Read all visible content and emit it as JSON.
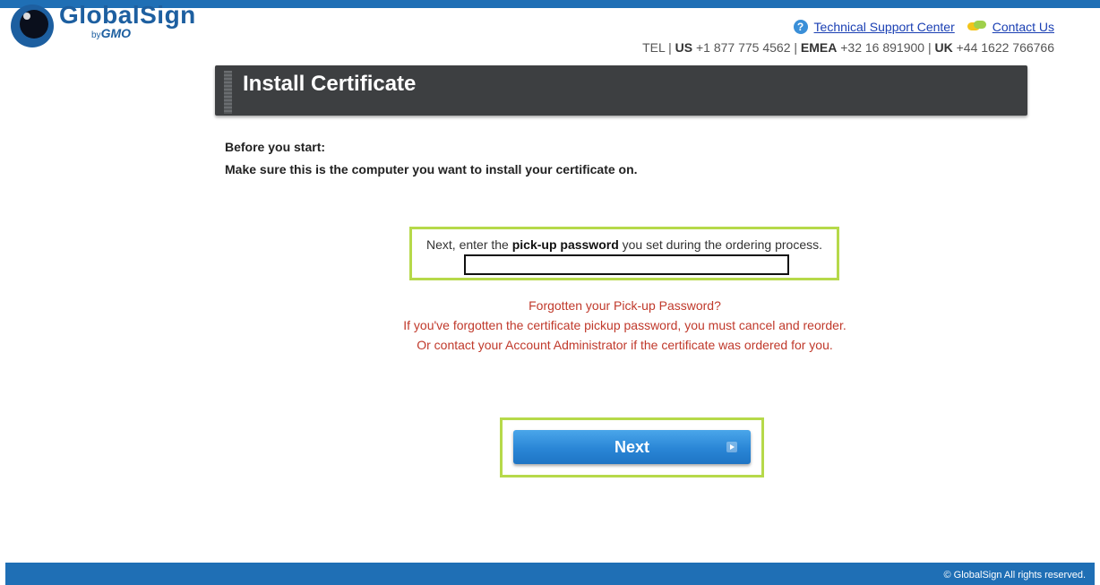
{
  "brand": {
    "name": "GlobalSign",
    "by": "by",
    "parent": "GMO"
  },
  "header": {
    "support_link": "Technical Support Center",
    "contact_link": "Contact Us",
    "tel_prefix": "TEL | ",
    "us_label": "US",
    "us_phone": " +1 877 775 4562 | ",
    "emea_label": "EMEA",
    "emea_phone": " +32 16 891900 | ",
    "uk_label": "UK",
    "uk_phone": " +44 1622 766766"
  },
  "page": {
    "title": "Install Certificate"
  },
  "intro": {
    "line1": "Before you start:",
    "line2": "Make sure this is the computer you want to install your certificate on."
  },
  "password": {
    "label_pre": "Next, enter the ",
    "label_bold": "pick-up password",
    "label_post": " you set during the ordering process.",
    "value": "",
    "placeholder": ""
  },
  "forgot": {
    "line1": "Forgotten your Pick-up Password?",
    "line2": "If you've forgotten the certificate pickup password, you must cancel and reorder.",
    "line3": "Or contact your Account Administrator if the certificate was ordered for you."
  },
  "next_button": {
    "label": "Next"
  },
  "footer": {
    "copyright": "© GlobalSign All rights reserved."
  },
  "colors": {
    "brand_blue": "#1f6fb5",
    "highlight_green": "#b6d94a",
    "warning_red": "#c0392b",
    "title_bar": "#3d3f41"
  }
}
